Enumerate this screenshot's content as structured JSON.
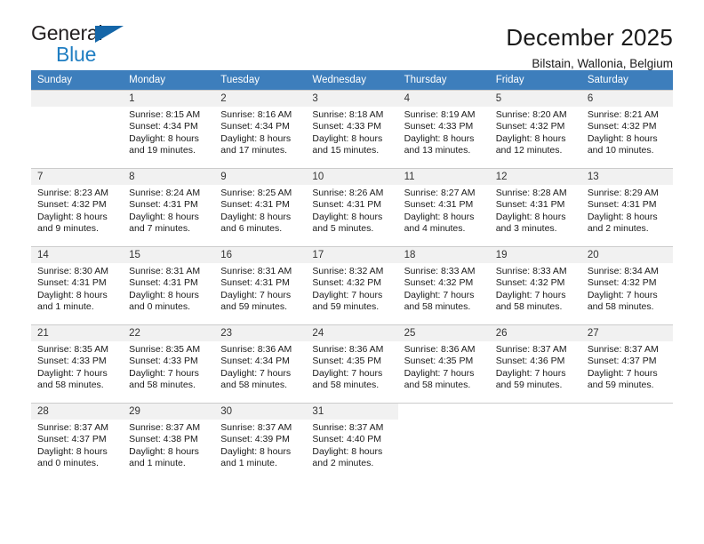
{
  "brand": {
    "name_top": "General",
    "name_bottom": "Blue",
    "triangle_color": "#1566a8",
    "blue_color": "#1f7ec2"
  },
  "header": {
    "title": "December 2025",
    "subtitle": "Bilstain, Wallonia, Belgium"
  },
  "theme": {
    "header_bg": "#3d7ebc",
    "daynum_bg": "#f1f1f1",
    "grid_line": "#cccccc"
  },
  "weekdays": [
    "Sunday",
    "Monday",
    "Tuesday",
    "Wednesday",
    "Thursday",
    "Friday",
    "Saturday"
  ],
  "weeks": [
    [
      {
        "day": "",
        "empty": true,
        "sunrise": "",
        "sunset": "",
        "daylight_l1": "",
        "daylight_l2": ""
      },
      {
        "day": "1",
        "sunrise": "Sunrise: 8:15 AM",
        "sunset": "Sunset: 4:34 PM",
        "daylight_l1": "Daylight: 8 hours",
        "daylight_l2": "and 19 minutes."
      },
      {
        "day": "2",
        "sunrise": "Sunrise: 8:16 AM",
        "sunset": "Sunset: 4:34 PM",
        "daylight_l1": "Daylight: 8 hours",
        "daylight_l2": "and 17 minutes."
      },
      {
        "day": "3",
        "sunrise": "Sunrise: 8:18 AM",
        "sunset": "Sunset: 4:33 PM",
        "daylight_l1": "Daylight: 8 hours",
        "daylight_l2": "and 15 minutes."
      },
      {
        "day": "4",
        "sunrise": "Sunrise: 8:19 AM",
        "sunset": "Sunset: 4:33 PM",
        "daylight_l1": "Daylight: 8 hours",
        "daylight_l2": "and 13 minutes."
      },
      {
        "day": "5",
        "sunrise": "Sunrise: 8:20 AM",
        "sunset": "Sunset: 4:32 PM",
        "daylight_l1": "Daylight: 8 hours",
        "daylight_l2": "and 12 minutes."
      },
      {
        "day": "6",
        "sunrise": "Sunrise: 8:21 AM",
        "sunset": "Sunset: 4:32 PM",
        "daylight_l1": "Daylight: 8 hours",
        "daylight_l2": "and 10 minutes."
      }
    ],
    [
      {
        "day": "7",
        "sunrise": "Sunrise: 8:23 AM",
        "sunset": "Sunset: 4:32 PM",
        "daylight_l1": "Daylight: 8 hours",
        "daylight_l2": "and 9 minutes."
      },
      {
        "day": "8",
        "sunrise": "Sunrise: 8:24 AM",
        "sunset": "Sunset: 4:31 PM",
        "daylight_l1": "Daylight: 8 hours",
        "daylight_l2": "and 7 minutes."
      },
      {
        "day": "9",
        "sunrise": "Sunrise: 8:25 AM",
        "sunset": "Sunset: 4:31 PM",
        "daylight_l1": "Daylight: 8 hours",
        "daylight_l2": "and 6 minutes."
      },
      {
        "day": "10",
        "sunrise": "Sunrise: 8:26 AM",
        "sunset": "Sunset: 4:31 PM",
        "daylight_l1": "Daylight: 8 hours",
        "daylight_l2": "and 5 minutes."
      },
      {
        "day": "11",
        "sunrise": "Sunrise: 8:27 AM",
        "sunset": "Sunset: 4:31 PM",
        "daylight_l1": "Daylight: 8 hours",
        "daylight_l2": "and 4 minutes."
      },
      {
        "day": "12",
        "sunrise": "Sunrise: 8:28 AM",
        "sunset": "Sunset: 4:31 PM",
        "daylight_l1": "Daylight: 8 hours",
        "daylight_l2": "and 3 minutes."
      },
      {
        "day": "13",
        "sunrise": "Sunrise: 8:29 AM",
        "sunset": "Sunset: 4:31 PM",
        "daylight_l1": "Daylight: 8 hours",
        "daylight_l2": "and 2 minutes."
      }
    ],
    [
      {
        "day": "14",
        "sunrise": "Sunrise: 8:30 AM",
        "sunset": "Sunset: 4:31 PM",
        "daylight_l1": "Daylight: 8 hours",
        "daylight_l2": "and 1 minute."
      },
      {
        "day": "15",
        "sunrise": "Sunrise: 8:31 AM",
        "sunset": "Sunset: 4:31 PM",
        "daylight_l1": "Daylight: 8 hours",
        "daylight_l2": "and 0 minutes."
      },
      {
        "day": "16",
        "sunrise": "Sunrise: 8:31 AM",
        "sunset": "Sunset: 4:31 PM",
        "daylight_l1": "Daylight: 7 hours",
        "daylight_l2": "and 59 minutes."
      },
      {
        "day": "17",
        "sunrise": "Sunrise: 8:32 AM",
        "sunset": "Sunset: 4:32 PM",
        "daylight_l1": "Daylight: 7 hours",
        "daylight_l2": "and 59 minutes."
      },
      {
        "day": "18",
        "sunrise": "Sunrise: 8:33 AM",
        "sunset": "Sunset: 4:32 PM",
        "daylight_l1": "Daylight: 7 hours",
        "daylight_l2": "and 58 minutes."
      },
      {
        "day": "19",
        "sunrise": "Sunrise: 8:33 AM",
        "sunset": "Sunset: 4:32 PM",
        "daylight_l1": "Daylight: 7 hours",
        "daylight_l2": "and 58 minutes."
      },
      {
        "day": "20",
        "sunrise": "Sunrise: 8:34 AM",
        "sunset": "Sunset: 4:32 PM",
        "daylight_l1": "Daylight: 7 hours",
        "daylight_l2": "and 58 minutes."
      }
    ],
    [
      {
        "day": "21",
        "sunrise": "Sunrise: 8:35 AM",
        "sunset": "Sunset: 4:33 PM",
        "daylight_l1": "Daylight: 7 hours",
        "daylight_l2": "and 58 minutes."
      },
      {
        "day": "22",
        "sunrise": "Sunrise: 8:35 AM",
        "sunset": "Sunset: 4:33 PM",
        "daylight_l1": "Daylight: 7 hours",
        "daylight_l2": "and 58 minutes."
      },
      {
        "day": "23",
        "sunrise": "Sunrise: 8:36 AM",
        "sunset": "Sunset: 4:34 PM",
        "daylight_l1": "Daylight: 7 hours",
        "daylight_l2": "and 58 minutes."
      },
      {
        "day": "24",
        "sunrise": "Sunrise: 8:36 AM",
        "sunset": "Sunset: 4:35 PM",
        "daylight_l1": "Daylight: 7 hours",
        "daylight_l2": "and 58 minutes."
      },
      {
        "day": "25",
        "sunrise": "Sunrise: 8:36 AM",
        "sunset": "Sunset: 4:35 PM",
        "daylight_l1": "Daylight: 7 hours",
        "daylight_l2": "and 58 minutes."
      },
      {
        "day": "26",
        "sunrise": "Sunrise: 8:37 AM",
        "sunset": "Sunset: 4:36 PM",
        "daylight_l1": "Daylight: 7 hours",
        "daylight_l2": "and 59 minutes."
      },
      {
        "day": "27",
        "sunrise": "Sunrise: 8:37 AM",
        "sunset": "Sunset: 4:37 PM",
        "daylight_l1": "Daylight: 7 hours",
        "daylight_l2": "and 59 minutes."
      }
    ],
    [
      {
        "day": "28",
        "sunrise": "Sunrise: 8:37 AM",
        "sunset": "Sunset: 4:37 PM",
        "daylight_l1": "Daylight: 8 hours",
        "daylight_l2": "and 0 minutes."
      },
      {
        "day": "29",
        "sunrise": "Sunrise: 8:37 AM",
        "sunset": "Sunset: 4:38 PM",
        "daylight_l1": "Daylight: 8 hours",
        "daylight_l2": "and 1 minute."
      },
      {
        "day": "30",
        "sunrise": "Sunrise: 8:37 AM",
        "sunset": "Sunset: 4:39 PM",
        "daylight_l1": "Daylight: 8 hours",
        "daylight_l2": "and 1 minute."
      },
      {
        "day": "31",
        "sunrise": "Sunrise: 8:37 AM",
        "sunset": "Sunset: 4:40 PM",
        "daylight_l1": "Daylight: 8 hours",
        "daylight_l2": "and 2 minutes."
      },
      {
        "day": "",
        "blank": true,
        "sunrise": "",
        "sunset": "",
        "daylight_l1": "",
        "daylight_l2": ""
      },
      {
        "day": "",
        "blank": true,
        "sunrise": "",
        "sunset": "",
        "daylight_l1": "",
        "daylight_l2": ""
      },
      {
        "day": "",
        "blank": true,
        "sunrise": "",
        "sunset": "",
        "daylight_l1": "",
        "daylight_l2": ""
      }
    ]
  ]
}
